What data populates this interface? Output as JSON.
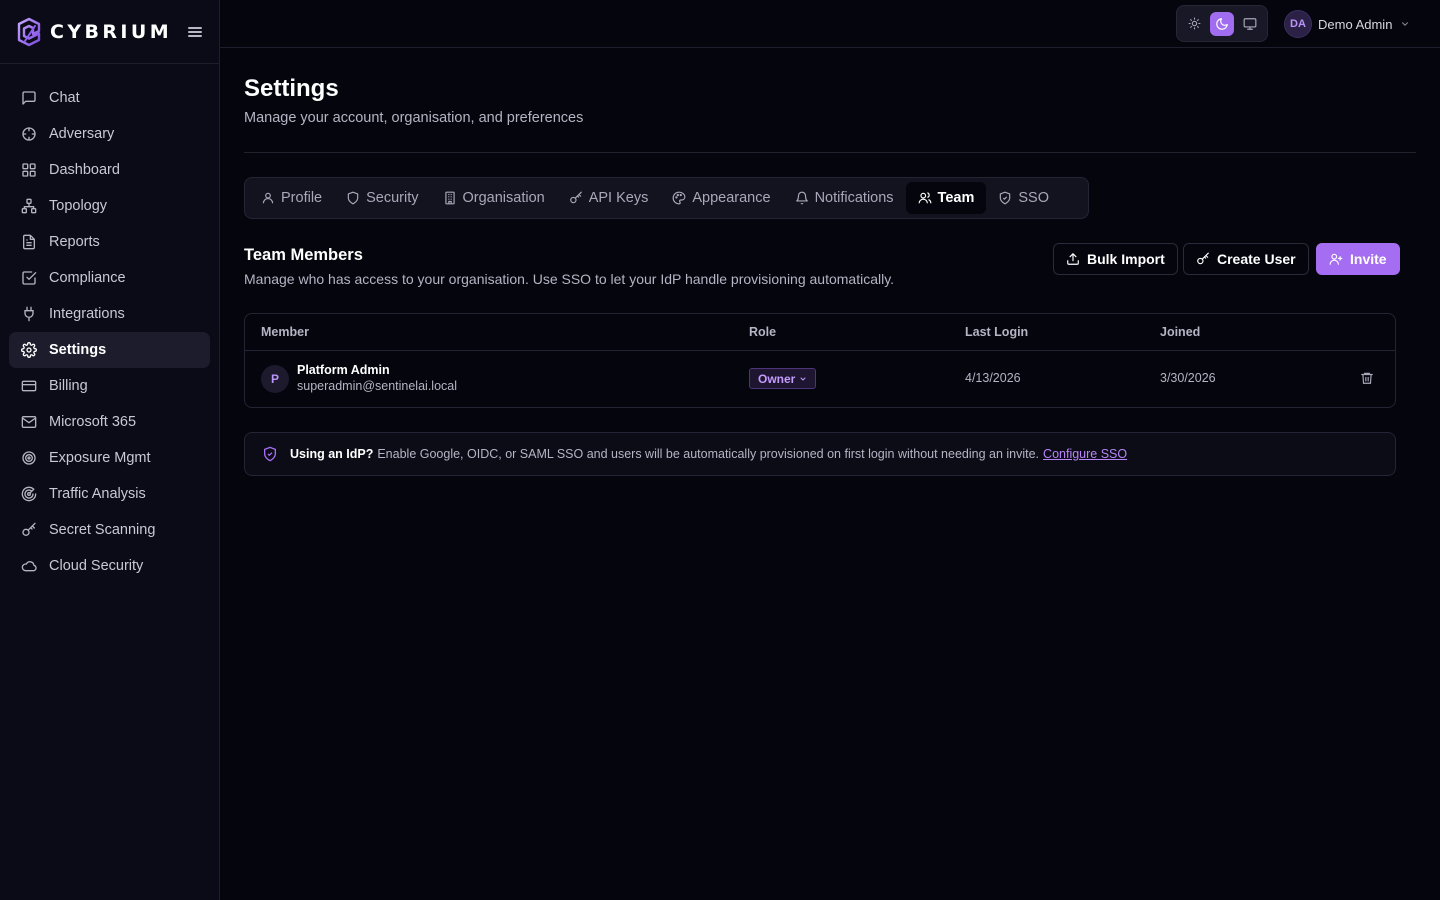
{
  "app": {
    "name": "CYBRIUM",
    "accent": "#a56ef2"
  },
  "sidebar": {
    "items": [
      {
        "label": "Chat",
        "icon": "message-square-icon"
      },
      {
        "label": "Adversary",
        "icon": "crosshair-icon"
      },
      {
        "label": "Dashboard",
        "icon": "layout-grid-icon"
      },
      {
        "label": "Topology",
        "icon": "network-icon"
      },
      {
        "label": "Reports",
        "icon": "file-text-icon"
      },
      {
        "label": "Compliance",
        "icon": "check-square-icon"
      },
      {
        "label": "Integrations",
        "icon": "plug-icon"
      },
      {
        "label": "Settings",
        "icon": "gear-icon",
        "active": true
      },
      {
        "label": "Billing",
        "icon": "credit-card-icon"
      },
      {
        "label": "Microsoft 365",
        "icon": "mail-icon"
      },
      {
        "label": "Exposure Mgmt",
        "icon": "target-icon"
      },
      {
        "label": "Traffic Analysis",
        "icon": "radar-icon"
      },
      {
        "label": "Secret Scanning",
        "icon": "key-icon"
      },
      {
        "label": "Cloud Security",
        "icon": "cloud-icon"
      }
    ]
  },
  "topbar": {
    "theme": {
      "options": [
        "light",
        "dark",
        "system"
      ],
      "active": "dark"
    },
    "user": {
      "initials": "DA",
      "name": "Demo Admin"
    }
  },
  "page": {
    "title": "Settings",
    "subtitle": "Manage your account, organisation, and preferences"
  },
  "tabs": [
    {
      "label": "Profile",
      "icon": "user-icon"
    },
    {
      "label": "Security",
      "icon": "shield-icon"
    },
    {
      "label": "Organisation",
      "icon": "building-icon"
    },
    {
      "label": "API Keys",
      "icon": "key-icon"
    },
    {
      "label": "Appearance",
      "icon": "palette-icon"
    },
    {
      "label": "Notifications",
      "icon": "bell-icon"
    },
    {
      "label": "Team",
      "icon": "users-icon",
      "active": true
    },
    {
      "label": "SSO",
      "icon": "shield-check-icon"
    }
  ],
  "team": {
    "title": "Team Members",
    "subtitle": "Manage who has access to your organisation. Use SSO to let your IdP handle provisioning automatically.",
    "actions": {
      "bulk_import": "Bulk Import",
      "create_user": "Create User",
      "invite": "Invite"
    },
    "columns": [
      "Member",
      "Role",
      "Last Login",
      "Joined"
    ],
    "members": [
      {
        "initial": "P",
        "name": "Platform Admin",
        "email": "superadmin@sentinelai.local",
        "role": "Owner",
        "last_login": "4/13/2026",
        "joined": "3/30/2026"
      }
    ]
  },
  "notice": {
    "bold": "Using an IdP?",
    "text": "Enable Google, OIDC, or SAML SSO and users will be automatically provisioned on first login without needing an invite.",
    "link": "Configure SSO"
  }
}
